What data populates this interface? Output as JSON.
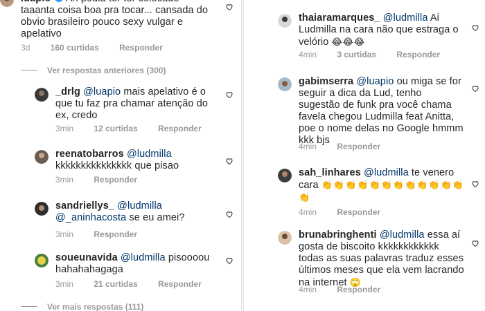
{
  "colors": {
    "text": "#262626",
    "meta": "#999999",
    "mention": "#003569",
    "divider": "#e6e6e6"
  },
  "left": {
    "top_comment": {
      "username": "luapio",
      "verified_icon": "verified-badge-icon",
      "text": "Ah podia ter ter colocado taaanta coisa boa pra tocar... cansada do obvio brasileiro pouco sexy vulgar e apelativo",
      "time": "3d",
      "likes": "160 curtidas",
      "reply": "Responder"
    },
    "view_previous": "Ver respostas anteriores (300)",
    "replies": [
      {
        "username": "_drlg",
        "mention": "@luapio",
        "text": "mais apelativo é o que tu faz pra chamar atenção do ex, credo",
        "time": "3min",
        "likes": "12 curtidas",
        "reply": "Responder"
      },
      {
        "username": "reenatobarros",
        "mention": "@ludmilla",
        "text": "kkkkkkkkkkkkkkk que pisao",
        "time": "3min",
        "likes": "",
        "reply": "Responder"
      },
      {
        "username": "sandriellys_",
        "mention": "@ludmilla",
        "mention2": "@_aninhacosta",
        "text": "se eu amei?",
        "time": "3min",
        "likes": "",
        "reply": "Responder"
      },
      {
        "username": "soueunavida",
        "mention": "@ludmilla",
        "text": "pisoooou hahahahagaga",
        "time": "3min",
        "likes": "21 curtidas",
        "reply": "Responder"
      }
    ],
    "view_more": "Ver mais respostas (111)"
  },
  "right": {
    "replies": [
      {
        "username": "thaiaramarques_",
        "mention": "@ludmilla",
        "text": "Ai Ludmilla na cara não que estraga o velório",
        "emoji": "😂😂😂",
        "time": "4min",
        "likes": "3 curtidas",
        "reply": "Responder"
      },
      {
        "username": "gabimserra",
        "mention": "@luapio",
        "text": "ou miga se for seguir a dica da Lud, tenho sugestão de funk pra você chama favela chegou Ludmilla feat Anitta, poe o nome delas no Google hmmm kkk bjs",
        "time": "4min",
        "likes": "",
        "reply": "Responder"
      },
      {
        "username": "sah_linhares",
        "mention": "@ludmilla",
        "text": "te venero cara",
        "emoji": "👏👏👏👏👏👏👏👏👏👏👏👏👏",
        "time": "4min",
        "likes": "",
        "reply": "Responder"
      },
      {
        "username": "brunabringhenti",
        "mention": "@ludmilla",
        "text": "essa aí gosta de biscoito kkkkkkkkkkkk todas as suas palavras traduz esses últimos meses que ela vem lacrando na internet",
        "emoji": "🙄",
        "time": "4min",
        "likes": "",
        "reply": "Responder"
      }
    ]
  }
}
